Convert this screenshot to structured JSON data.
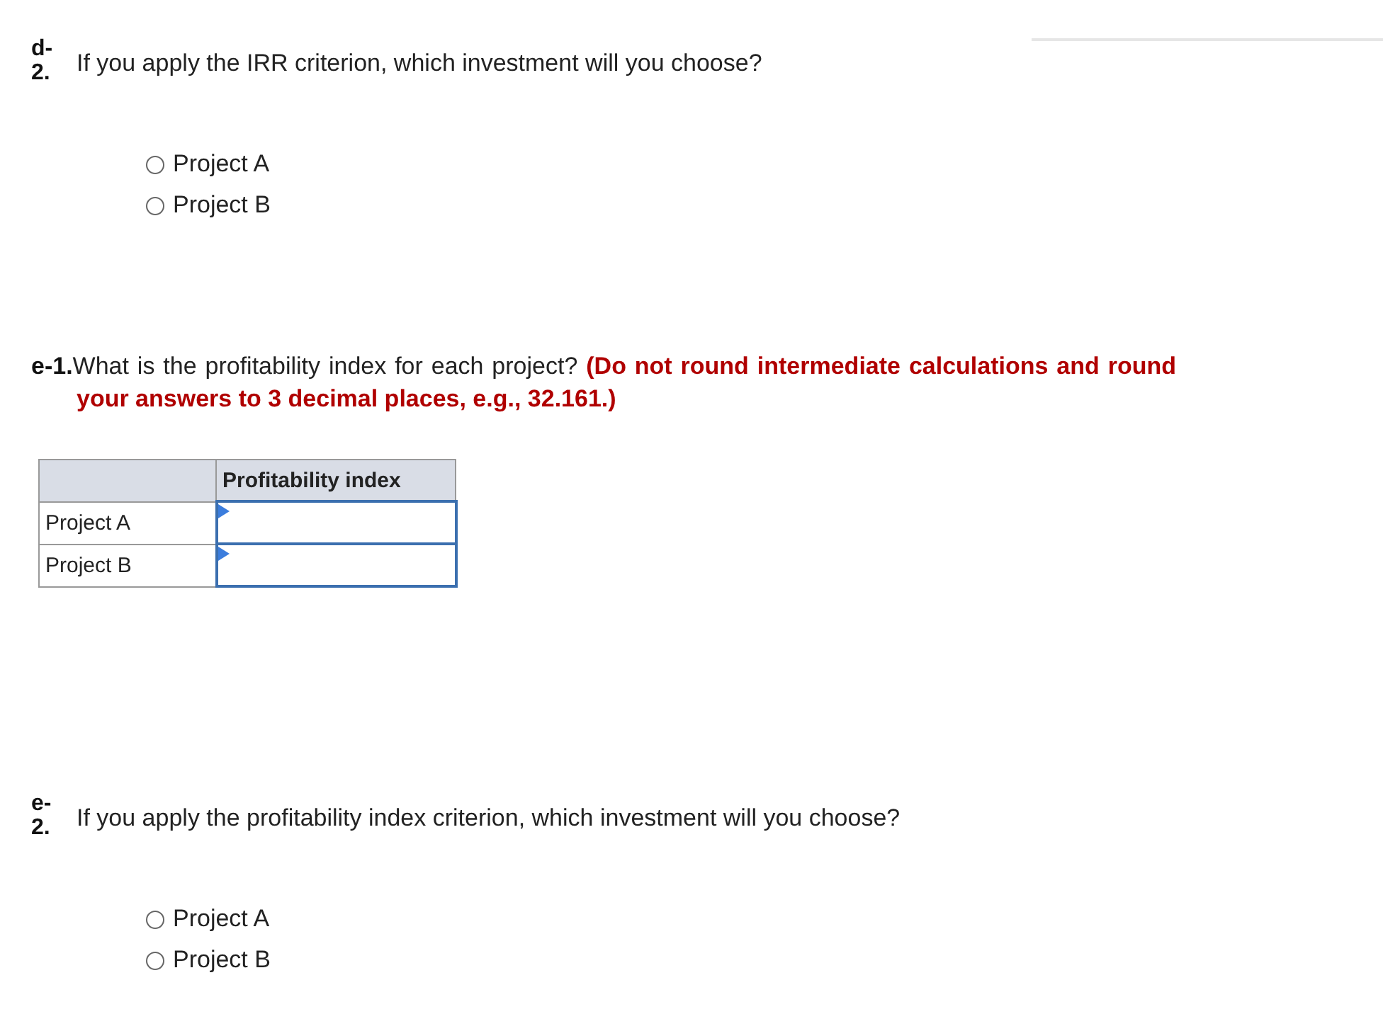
{
  "questions": [
    {
      "kind": "choice",
      "number": "d-2.",
      "prompt": "If you apply the IRR criterion, which investment will you choose?",
      "options": [
        {
          "label": "Project A",
          "selected": false
        },
        {
          "label": "Project B",
          "selected": false
        }
      ]
    },
    {
      "kind": "table",
      "text": "**e-1.**What is the profitability index for each project? **(Do not round intermediate calculations and round your answers to 3 decimal places, e.g., 32.161.)**",
      "column_header": "Profitability index",
      "rows": [
        {
          "label": "Project A"
        },
        {
          "label": "Project B"
        }
      ]
    },
    {
      "kind": "choice",
      "number": "e-2.",
      "prompt": "If you apply the profitability index criterion, which investment will you choose?",
      "options": [
        {
          "label": "Project A",
          "selected": false
        },
        {
          "label": "Project B",
          "selected": false
        }
      ]
    }
  ]
}
